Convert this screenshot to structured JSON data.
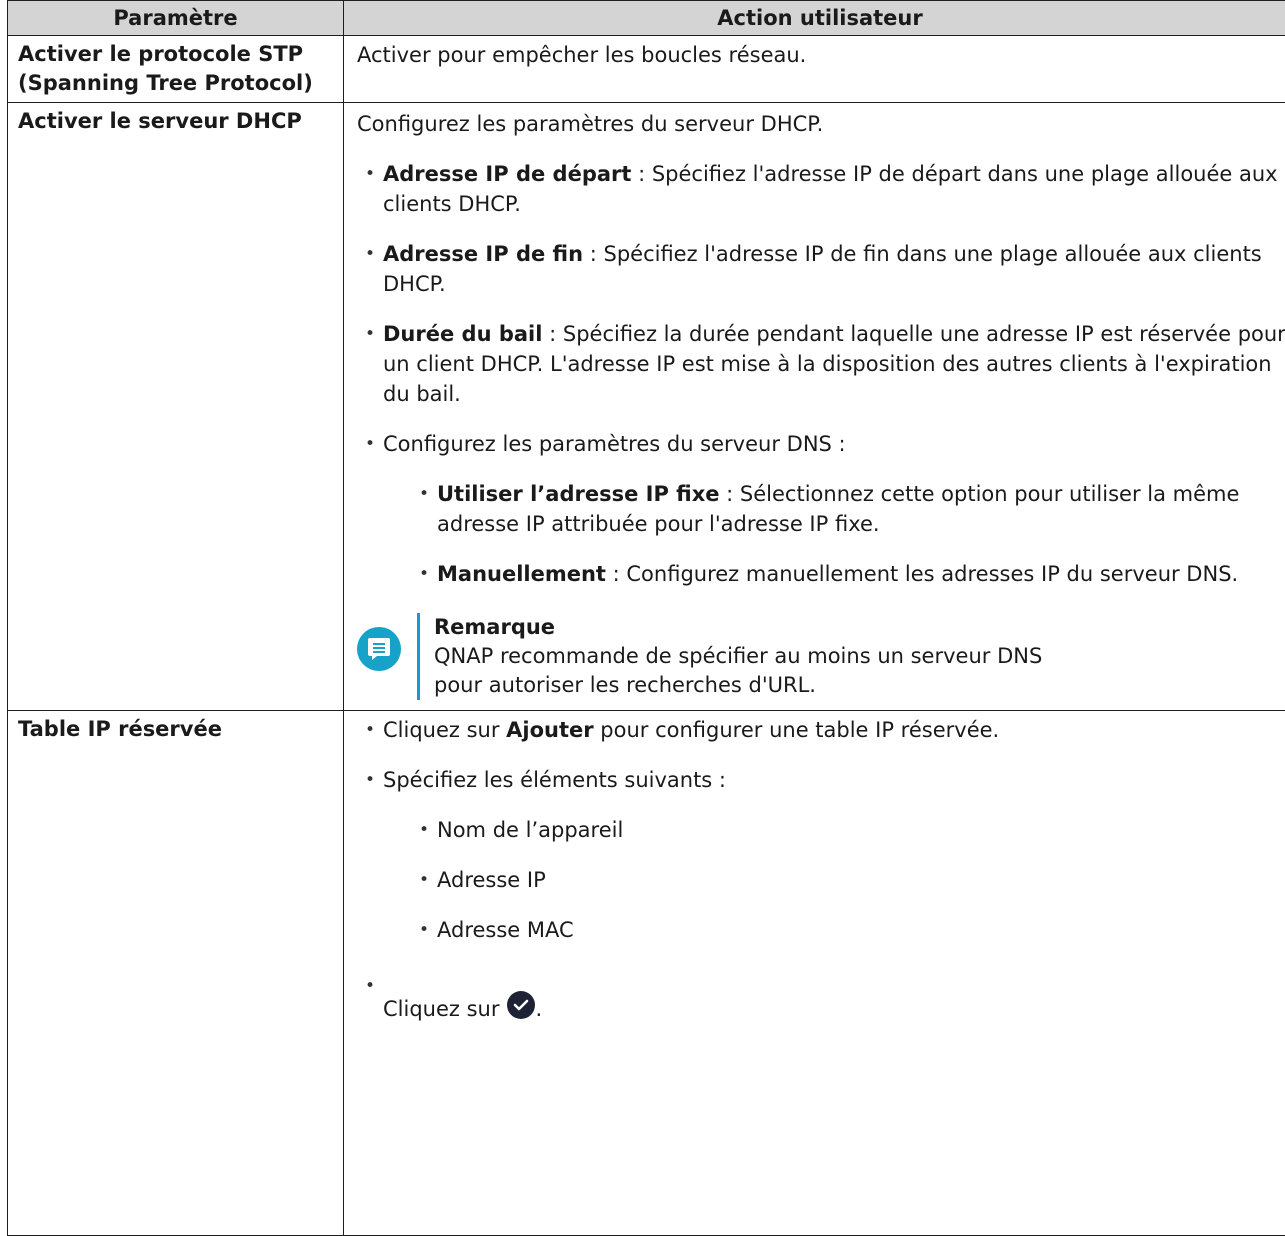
{
  "header": {
    "col1": "Paramètre",
    "col2": "Action utilisateur"
  },
  "rows": {
    "stp": {
      "param": "Activer le protocole STP (Spanning Tree Protocol)",
      "action": "Activer pour empêcher les boucles réseau."
    },
    "dhcp": {
      "param": "Activer le serveur DHCP",
      "intro": "Configurez les paramètres du serveur DHCP.",
      "items": [
        {
          "label": "Adresse IP de départ",
          "text": " : Spécifiez l'adresse IP de départ dans une plage allouée aux clients DHCP."
        },
        {
          "label": "Adresse IP de fin",
          "text": " : Spécifiez l'adresse IP de fin dans une plage allouée aux clients DHCP."
        },
        {
          "label": "Durée du bail",
          "text": " : Spécifiez la durée pendant laquelle une adresse IP est réservée pour un client DHCP. L'adresse IP est mise à la disposition des autres clients à l'expiration du bail."
        }
      ],
      "dns_item": "Configurez les paramètres du serveur DNS :",
      "dns_subitems": [
        {
          "label": "Utiliser l’adresse IP fixe",
          "text": " : Sélectionnez cette option pour utiliser la même adresse IP attribuée pour l'adresse IP fixe."
        },
        {
          "label": "Manuellement",
          "text": " : Configurez manuellement les adresses IP du serveur DNS."
        }
      ],
      "note": {
        "title": "Remarque",
        "line1": "QNAP recommande de spécifier au moins un serveur DNS",
        "line2": "pour autoriser les recherches d'URL."
      }
    },
    "reserved": {
      "param": "Table IP réservée",
      "item1_pre": "Cliquez sur ",
      "item1_bold": "Ajouter",
      "item1_post": " pour configurer une table IP réservée.",
      "item2": "Spécifiez les éléments suivants :",
      "subitems": [
        "Nom de l’appareil",
        "Adresse IP",
        "Adresse MAC"
      ],
      "item3": "Cliquez sur",
      "item3_end": "."
    }
  },
  "icons": {
    "note": "note-icon",
    "confirm": "checkmark-circle-icon"
  },
  "colors": {
    "header_bg": "#d4d4d4",
    "note_icon": "#16a2c9",
    "note_bar": "#1b97d3",
    "check_icon": "#1e2235"
  }
}
